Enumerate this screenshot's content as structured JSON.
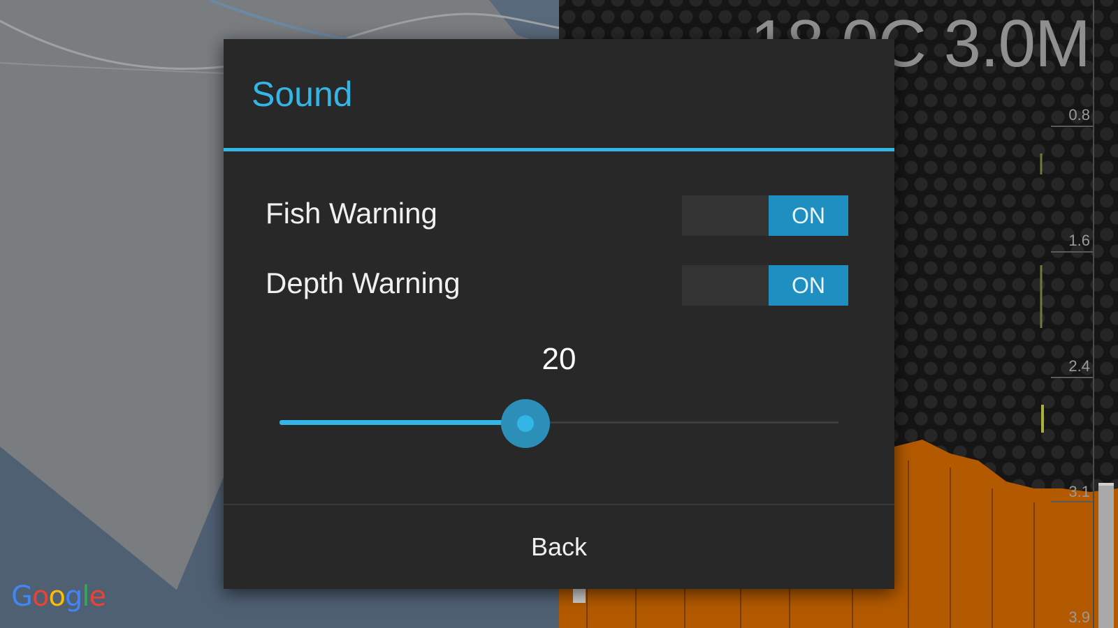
{
  "map": {
    "attribution_letters": [
      {
        "char": "G",
        "color": "#4285f4"
      },
      {
        "char": "o",
        "color": "#ea4335"
      },
      {
        "char": "o",
        "color": "#fbbc05"
      },
      {
        "char": "g",
        "color": "#4285f4"
      },
      {
        "char": "l",
        "color": "#34a853"
      },
      {
        "char": "e",
        "color": "#ea4335"
      }
    ]
  },
  "sonar": {
    "readout": "18.0C 3.0M",
    "depth_ticks": [
      "0.8",
      "1.6",
      "2.4",
      "3.1",
      "3.9"
    ],
    "bottom_color": "#b35a00"
  },
  "dialog": {
    "title": "Sound",
    "accent_color": "#33b5e5",
    "settings": [
      {
        "label": "Fish Warning",
        "state": "ON"
      },
      {
        "label": "Depth Warning",
        "state": "ON"
      }
    ],
    "volume": {
      "value": "20",
      "fraction": 0.44
    },
    "back_label": "Back"
  }
}
